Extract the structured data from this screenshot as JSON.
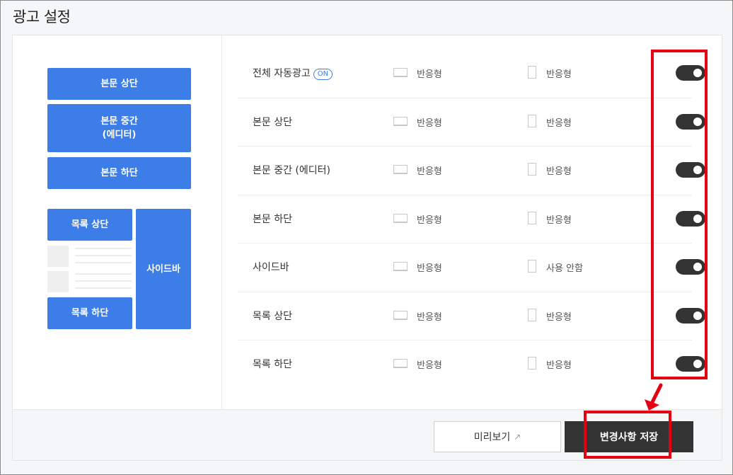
{
  "page": {
    "title": "광고 설정"
  },
  "layout_preview": {
    "post_top": "본문 상단",
    "post_middle": "본문 중간\n(에디터)",
    "post_bottom": "본문 하단",
    "list_top": "목록 상단",
    "list_bottom": "목록 하단",
    "sidebar": "사이드바"
  },
  "ad_rows": [
    {
      "label": "전체 자동광고",
      "badge": "ON",
      "pc": "반응형",
      "mobile": "반응형",
      "enabled": true
    },
    {
      "label": "본문 상단",
      "pc": "반응형",
      "mobile": "반응형",
      "enabled": true
    },
    {
      "label": "본문 중간 (에디터)",
      "pc": "반응형",
      "mobile": "반응형",
      "enabled": true
    },
    {
      "label": "본문 하단",
      "pc": "반응형",
      "mobile": "반응형",
      "enabled": true
    },
    {
      "label": "사이드바",
      "pc": "반응형",
      "mobile": "사용 안함",
      "enabled": true
    },
    {
      "label": "목록 상단",
      "pc": "반응형",
      "mobile": "반응형",
      "enabled": true
    },
    {
      "label": "목록 하단",
      "pc": "반응형",
      "mobile": "반응형",
      "enabled": true
    }
  ],
  "footer": {
    "preview_label": "미리보기",
    "save_label": "변경사항 저장"
  },
  "colors": {
    "accent": "#3d7de8",
    "toggle_on": "#333333",
    "annotation": "#e60012"
  },
  "icons": {
    "pc": "desktop-monitor-icon",
    "mobile": "mobile-phone-icon",
    "preview": "external-link-icon",
    "annotation": "red-arrow-icon"
  }
}
